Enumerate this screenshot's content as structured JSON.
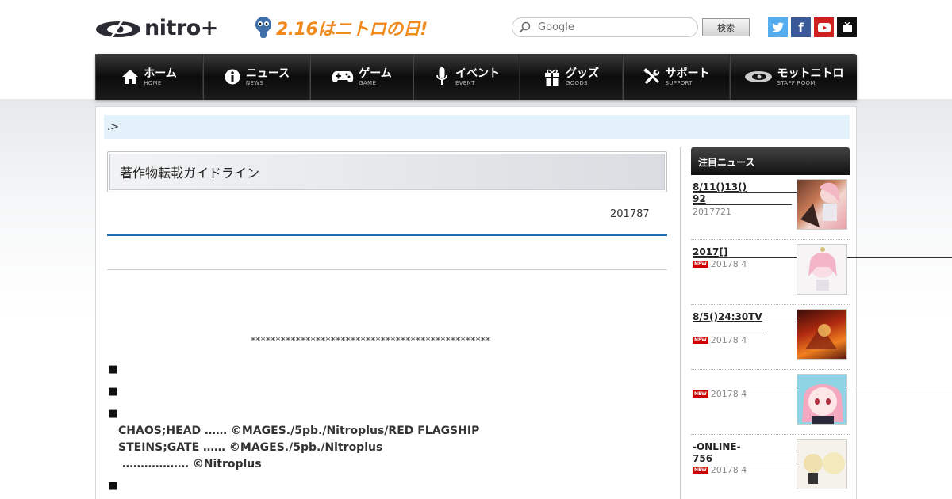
{
  "header": {
    "logo_text": "nitro+",
    "promo_text": "2.16はニトロの日!",
    "search_placeholder": "Google",
    "search_button": "検索",
    "social": [
      "twitter-icon",
      "facebook-icon",
      "youtube-icon",
      "niconico-icon"
    ]
  },
  "nav": [
    {
      "jp": "ホーム",
      "en": "HOME",
      "icon": "home-icon"
    },
    {
      "jp": "ニュース",
      "en": "NEWS",
      "icon": "info-icon"
    },
    {
      "jp": "ゲーム",
      "en": "GAME",
      "icon": "gamepad-icon"
    },
    {
      "jp": "イベント",
      "en": "EVENT",
      "icon": "microphone-icon"
    },
    {
      "jp": "グッズ",
      "en": "GOODS",
      "icon": "gift-icon"
    },
    {
      "jp": "サポート",
      "en": "SUPPORT",
      "icon": "tools-icon"
    },
    {
      "jp": "モットニトロ",
      "en": "STAFF ROOM",
      "icon": "nitro-logo-icon"
    }
  ],
  "breadcrumb": ".>",
  "page_title": "著作物転載ガイドライン",
  "date": "201787",
  "stars": "************************************************",
  "credits": [
    "CHAOS;HEAD …… ©MAGES./5pb./Nitroplus/RED FLAGSHIP",
    "STEINS;GATE …… ©MAGES./5pb./Nitroplus",
    " ……………… ©Nitroplus"
  ],
  "sidebar": {
    "title": "注目ニュース",
    "new_label": "NEW",
    "items": [
      {
        "title": "8/11()13()\n92",
        "meta": "2017721",
        "new": false
      },
      {
        "title": "2017[]",
        "meta": "20178 4",
        "new": true
      },
      {
        "title": "8/5()24:30TV",
        "meta": "20178 4",
        "new": true
      },
      {
        "title": "",
        "meta": "20178 4",
        "new": true
      },
      {
        "title": "-ONLINE-\n756",
        "meta": "20178 4",
        "new": true
      }
    ]
  },
  "colors": {
    "brand_orange": "#f08a1c",
    "rule_blue": "#1d6fb8",
    "breadcrumb_bg": "#e3f1fb",
    "new_badge": "#cc0000"
  }
}
